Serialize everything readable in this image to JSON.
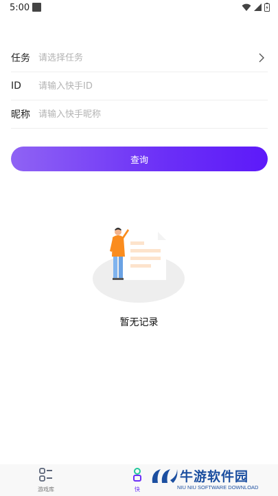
{
  "status_bar": {
    "time": "5:00",
    "icons": [
      "notification-icon",
      "wifi-icon",
      "signal-icon",
      "battery-icon"
    ]
  },
  "form": {
    "task": {
      "label": "任务",
      "placeholder": "请选择任务"
    },
    "id": {
      "label": "ID",
      "placeholder": "请输入快手ID"
    },
    "nickname": {
      "label": "昵称",
      "placeholder": "请输入快手昵称"
    }
  },
  "query_button": {
    "label": "查询"
  },
  "empty_state": {
    "text": "暂无记录"
  },
  "bottom_nav": {
    "items": [
      {
        "label": "游戏库",
        "icon": "game-library-icon"
      },
      {
        "label": "快",
        "icon": "kuaishou-icon"
      }
    ]
  },
  "watermark": {
    "title": "牛游软件园",
    "subtitle": "NIU NIU SOFTWARE DOWNLOAD"
  },
  "colors": {
    "accent_start": "#8f63f4",
    "accent_end": "#5d1af9",
    "divider": "#eeeeee",
    "placeholder": "#b3b3b3"
  }
}
